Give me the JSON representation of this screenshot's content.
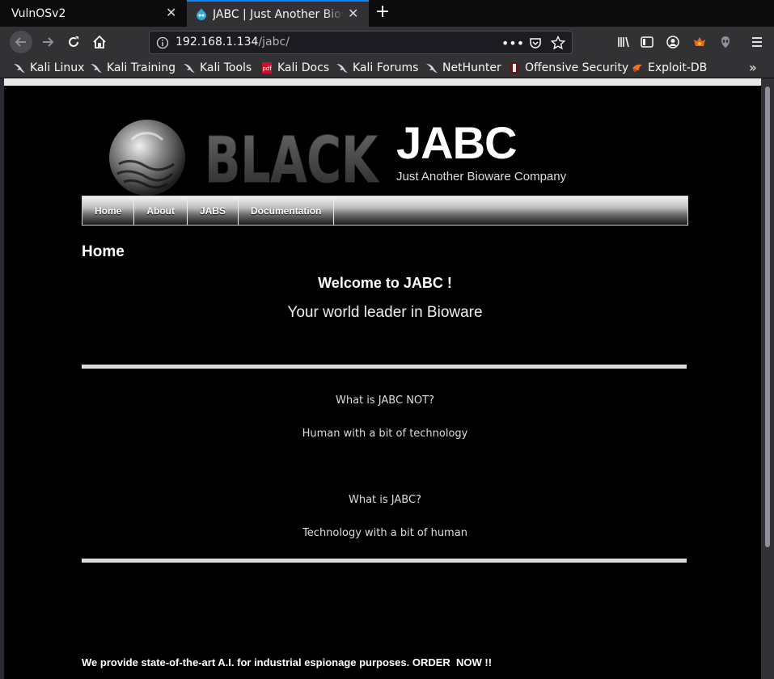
{
  "tabs": [
    {
      "title": "VulnOSv2"
    },
    {
      "title": "JABC | Just Another Bioware Company"
    }
  ],
  "address_bar": {
    "host": "192.168.1.134",
    "path": "/jabc/"
  },
  "bookmarks": [
    {
      "label": "Kali Linux",
      "icon": "kali-dragon-icon"
    },
    {
      "label": "Kali Training",
      "icon": "kali-dragon-icon"
    },
    {
      "label": "Kali Tools",
      "icon": "kali-dragon-icon"
    },
    {
      "label": "Kali Docs",
      "icon": "pdf-icon"
    },
    {
      "label": "Kali Forums",
      "icon": "kali-dragon-icon"
    },
    {
      "label": "NetHunter",
      "icon": "kali-dragon-icon"
    },
    {
      "label": "Offensive Security",
      "icon": "offsec-icon"
    },
    {
      "label": "Exploit-DB",
      "icon": "exploit-db-icon"
    }
  ],
  "site": {
    "logo_text": "BLACK",
    "name": "JABC",
    "slogan": "Just Another Bioware Company",
    "menu": [
      "Home",
      "About",
      "JABS",
      "Documentation"
    ],
    "page_title": "Home",
    "welcome": "Welcome to JABC !",
    "tagline": "Your world leader in Bioware",
    "q1": "What is JABC NOT?",
    "a1": "Human with a bit of technology",
    "q2": "What is JABC?",
    "a2": "Technology with a bit of human",
    "footer": "We provide state-of-the-art A.I. for industrial espionage purposes. ORDER  NOW !!"
  },
  "colors": {
    "accent": "#0a84ff",
    "page_bg": "#000000",
    "chrome_bg": "#323234"
  }
}
